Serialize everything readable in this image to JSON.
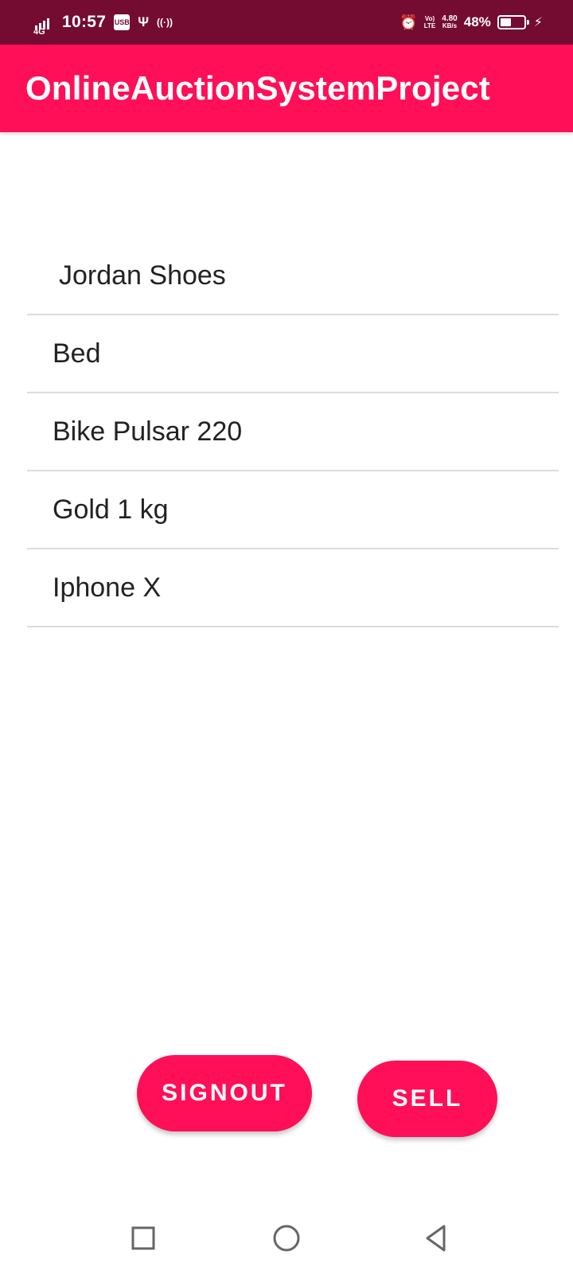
{
  "status_bar": {
    "network": "4G",
    "time": "10:57",
    "notif_icons": [
      "usb-debug-icon",
      "usb-icon",
      "hotspot-icon"
    ],
    "usb_debug_glyph": "USB",
    "usb_glyph": "Ψ",
    "hotspot_glyph": "((·))",
    "alarm_glyph": "⏰",
    "volte_top": "Vo)",
    "volte_bottom": "LTE",
    "speed_value": "4.80",
    "speed_unit": "KB/s",
    "battery_percent": "48%",
    "battery_level": 0.48,
    "charging_glyph": "⚡"
  },
  "app_bar": {
    "title": "OnlineAuctionSystemProject"
  },
  "items": [
    "Jordan Shoes",
    "Bed",
    "Bike Pulsar 220",
    "Gold 1 kg",
    "Iphone X"
  ],
  "buttons": {
    "signout_label": "SIGNOUT",
    "sell_label": "SELL"
  },
  "nav_bar": {
    "icons": [
      "recent-apps-icon",
      "home-icon",
      "back-icon"
    ]
  },
  "colors": {
    "status_bar": "#740c31",
    "accent": "#ff0f57",
    "divider": "#dcdcdc"
  }
}
